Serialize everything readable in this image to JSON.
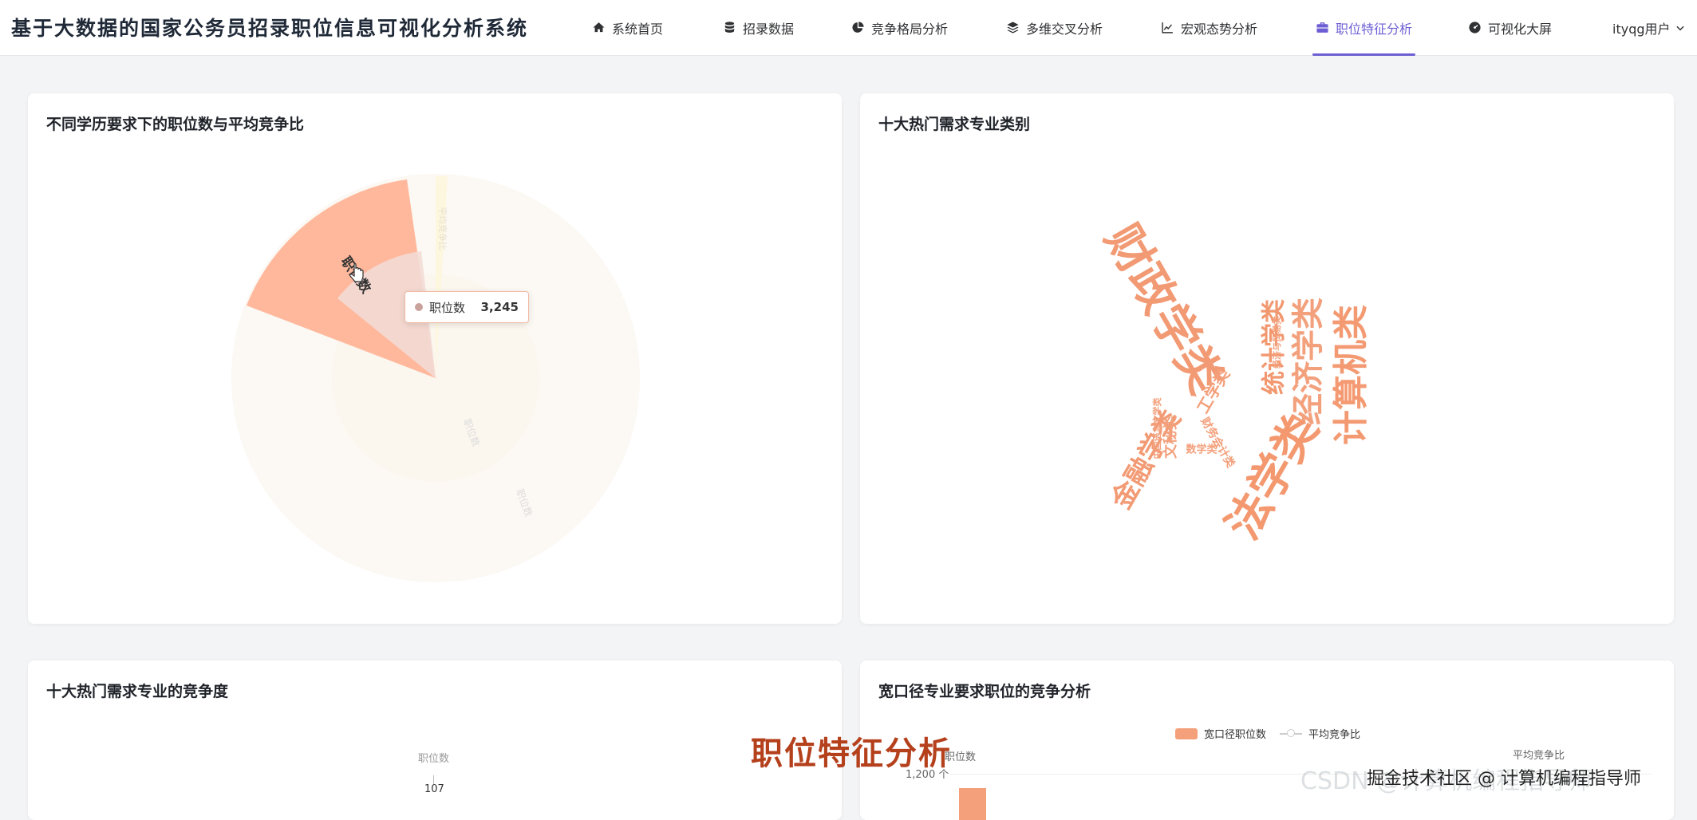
{
  "app": {
    "title": "基于大数据的国家公务员招录职位信息可视化分析系统"
  },
  "nav": {
    "items": [
      {
        "label": "系统首页",
        "icon": "home-icon"
      },
      {
        "label": "招录数据",
        "icon": "database-icon"
      },
      {
        "label": "竞争格局分析",
        "icon": "pie-chart-icon"
      },
      {
        "label": "多维交叉分析",
        "icon": "layers-icon"
      },
      {
        "label": "宏观态势分析",
        "icon": "line-chart-icon"
      },
      {
        "label": "职位特征分析",
        "icon": "briefcase-icon",
        "active": true
      },
      {
        "label": "可视化大屏",
        "icon": "dashboard-icon"
      }
    ],
    "user": "ityqg用户"
  },
  "cards": {
    "education": {
      "title": "不同学历要求下的职位数与平均竞争比",
      "slice_label": "职位数",
      "tooltip": {
        "series": "职位数",
        "value": "3,245"
      },
      "faint_labels": [
        "职位数",
        "职位数",
        "平均竞争比"
      ]
    },
    "majors": {
      "title": "十大热门需求专业类别"
    },
    "major_competition": {
      "title": "十大热门需求专业的竞争度",
      "axis_name": "职位数",
      "axis_value": "107"
    },
    "broad": {
      "title": "宽口径专业要求职位的竞争分析",
      "legend": [
        "宽口径职位数",
        "平均竞争比"
      ],
      "y_left_name": "职位数",
      "y_left_tick": "1,200 个",
      "y_right_name": "平均竞争比"
    }
  },
  "overlay": {
    "caption": "职位特征分析",
    "watermark": "CSDN @计算机编程指导师",
    "source": "掘金技术社区 @ 计算机编程指导师"
  },
  "colors": {
    "accent": "#6d5fd3",
    "chart_primary": "#f4a07a",
    "caption": "#b5401c"
  },
  "chart_data": [
    {
      "type": "pie",
      "title": "不同学历要求下的职位数与平均竞争比",
      "series": [
        {
          "name": "职位数",
          "values": [
            3245
          ]
        }
      ]
    },
    {
      "type": "wordcloud",
      "title": "十大热门需求专业类别",
      "words": [
        "财政学类",
        "计算机类",
        "经济学类",
        "统计学类",
        "金融学类",
        "法学类",
        "中国语言文学类",
        "经济与贸易类",
        "财务会计类",
        "数学类",
        "工学类",
        "文秘类"
      ]
    }
  ]
}
